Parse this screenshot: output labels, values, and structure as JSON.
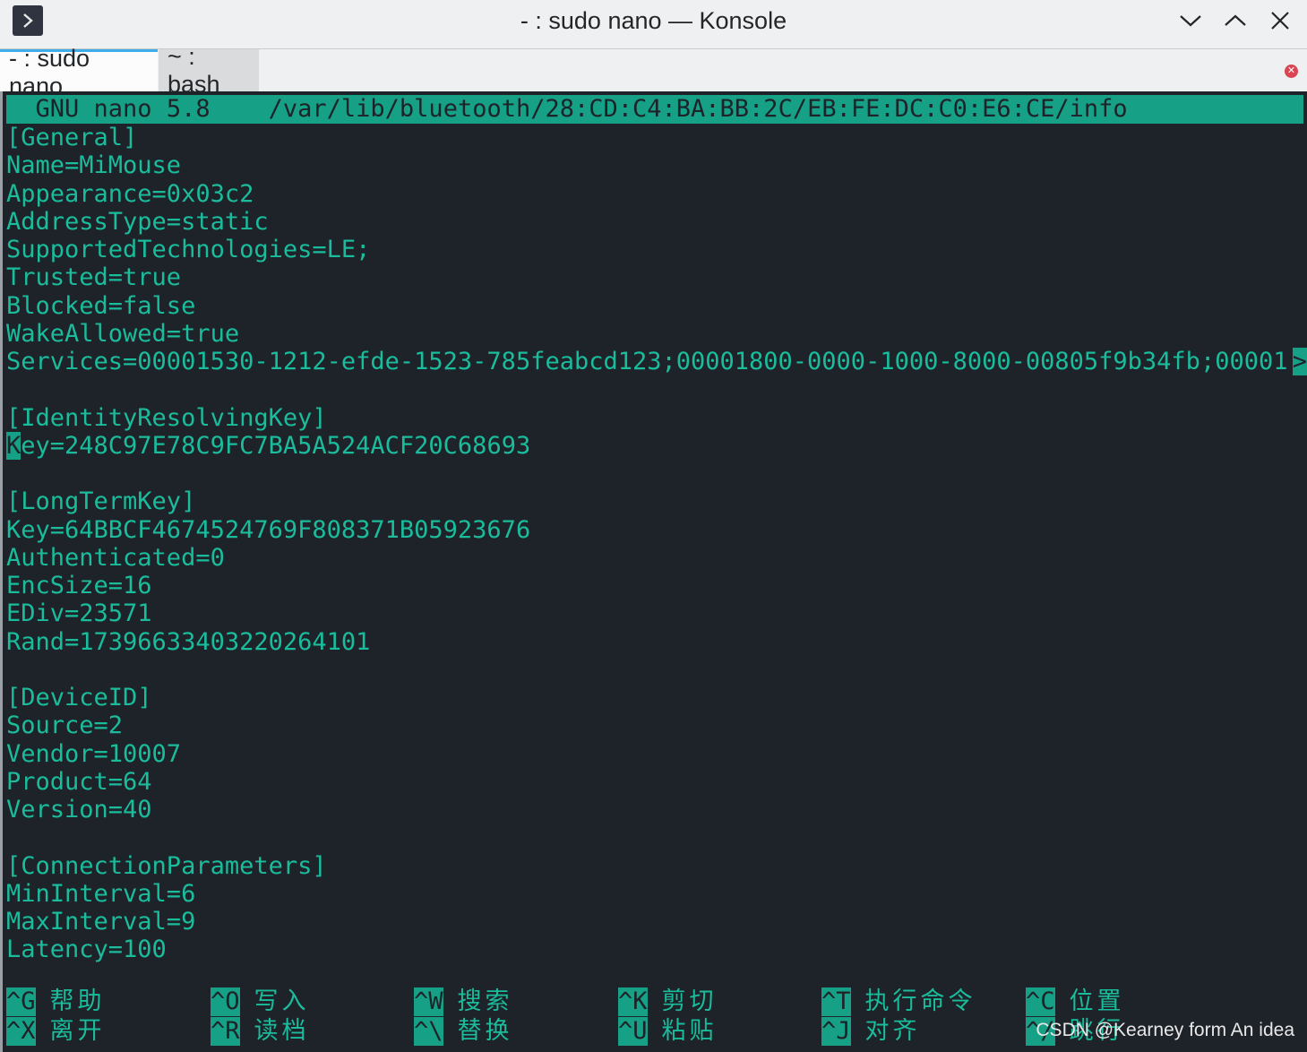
{
  "window": {
    "title": "- : sudo nano — Konsole"
  },
  "tabs": [
    {
      "label": "- : sudo nano",
      "active": true
    },
    {
      "label": "~ : bash",
      "active": false
    }
  ],
  "nano": {
    "version": "GNU nano 5.8",
    "path": "/var/lib/bluetooth/28:CD:C4:BA:BB:2C/EB:FE:DC:C0:E6:CE/info"
  },
  "file_lines": [
    "[General]",
    "Name=MiMouse",
    "Appearance=0x03c2",
    "AddressType=static",
    "SupportedTechnologies=LE;",
    "Trusted=true",
    "Blocked=false",
    "WakeAllowed=true",
    "Services=00001530-1212-efde-1523-785feabcd123;00001800-0000-1000-8000-00805f9b34fb;00001",
    "",
    "[IdentityResolvingKey]",
    "ey=248C97E78C9FC7BA5A524ACF20C68693",
    "",
    "[LongTermKey]",
    "Key=64BBCF4674524769F808371B05923676",
    "Authenticated=0",
    "EncSize=16",
    "EDiv=23571",
    "Rand=17396633403220264101",
    "",
    "[DeviceID]",
    "Source=2",
    "Vendor=10007",
    "Product=64",
    "Version=40",
    "",
    "[ConnectionParameters]",
    "MinInterval=6",
    "MaxInterval=9",
    "Latency=100"
  ],
  "cursor_char": "K",
  "overflow_marker": ">",
  "shortcuts": [
    {
      "key": "^G",
      "label": "帮助"
    },
    {
      "key": "^X",
      "label": "离开"
    },
    {
      "key": "^O",
      "label": "写入"
    },
    {
      "key": "^R",
      "label": "读档"
    },
    {
      "key": "^W",
      "label": "搜索"
    },
    {
      "key": "^\\",
      "label": "替换"
    },
    {
      "key": "^K",
      "label": "剪切"
    },
    {
      "key": "^U",
      "label": "粘贴"
    },
    {
      "key": "^T",
      "label": "执行命令"
    },
    {
      "key": "^J",
      "label": "对齐"
    },
    {
      "key": "^C",
      "label": "位置"
    },
    {
      "key": "^/",
      "label": "跳行"
    }
  ],
  "watermark": "CSDN @Kearney form An idea",
  "icons": {
    "app": "terminal-icon",
    "minimize": "chevron-down-icon",
    "maximize": "chevron-up-icon",
    "close": "close-icon",
    "tab_close": "close-icon"
  },
  "colors": {
    "terminal_bg": "#1e2229",
    "terminal_fg": "#1abc9c",
    "highlight_bg": "#16a085",
    "chrome_bg": "#eff0f1"
  }
}
